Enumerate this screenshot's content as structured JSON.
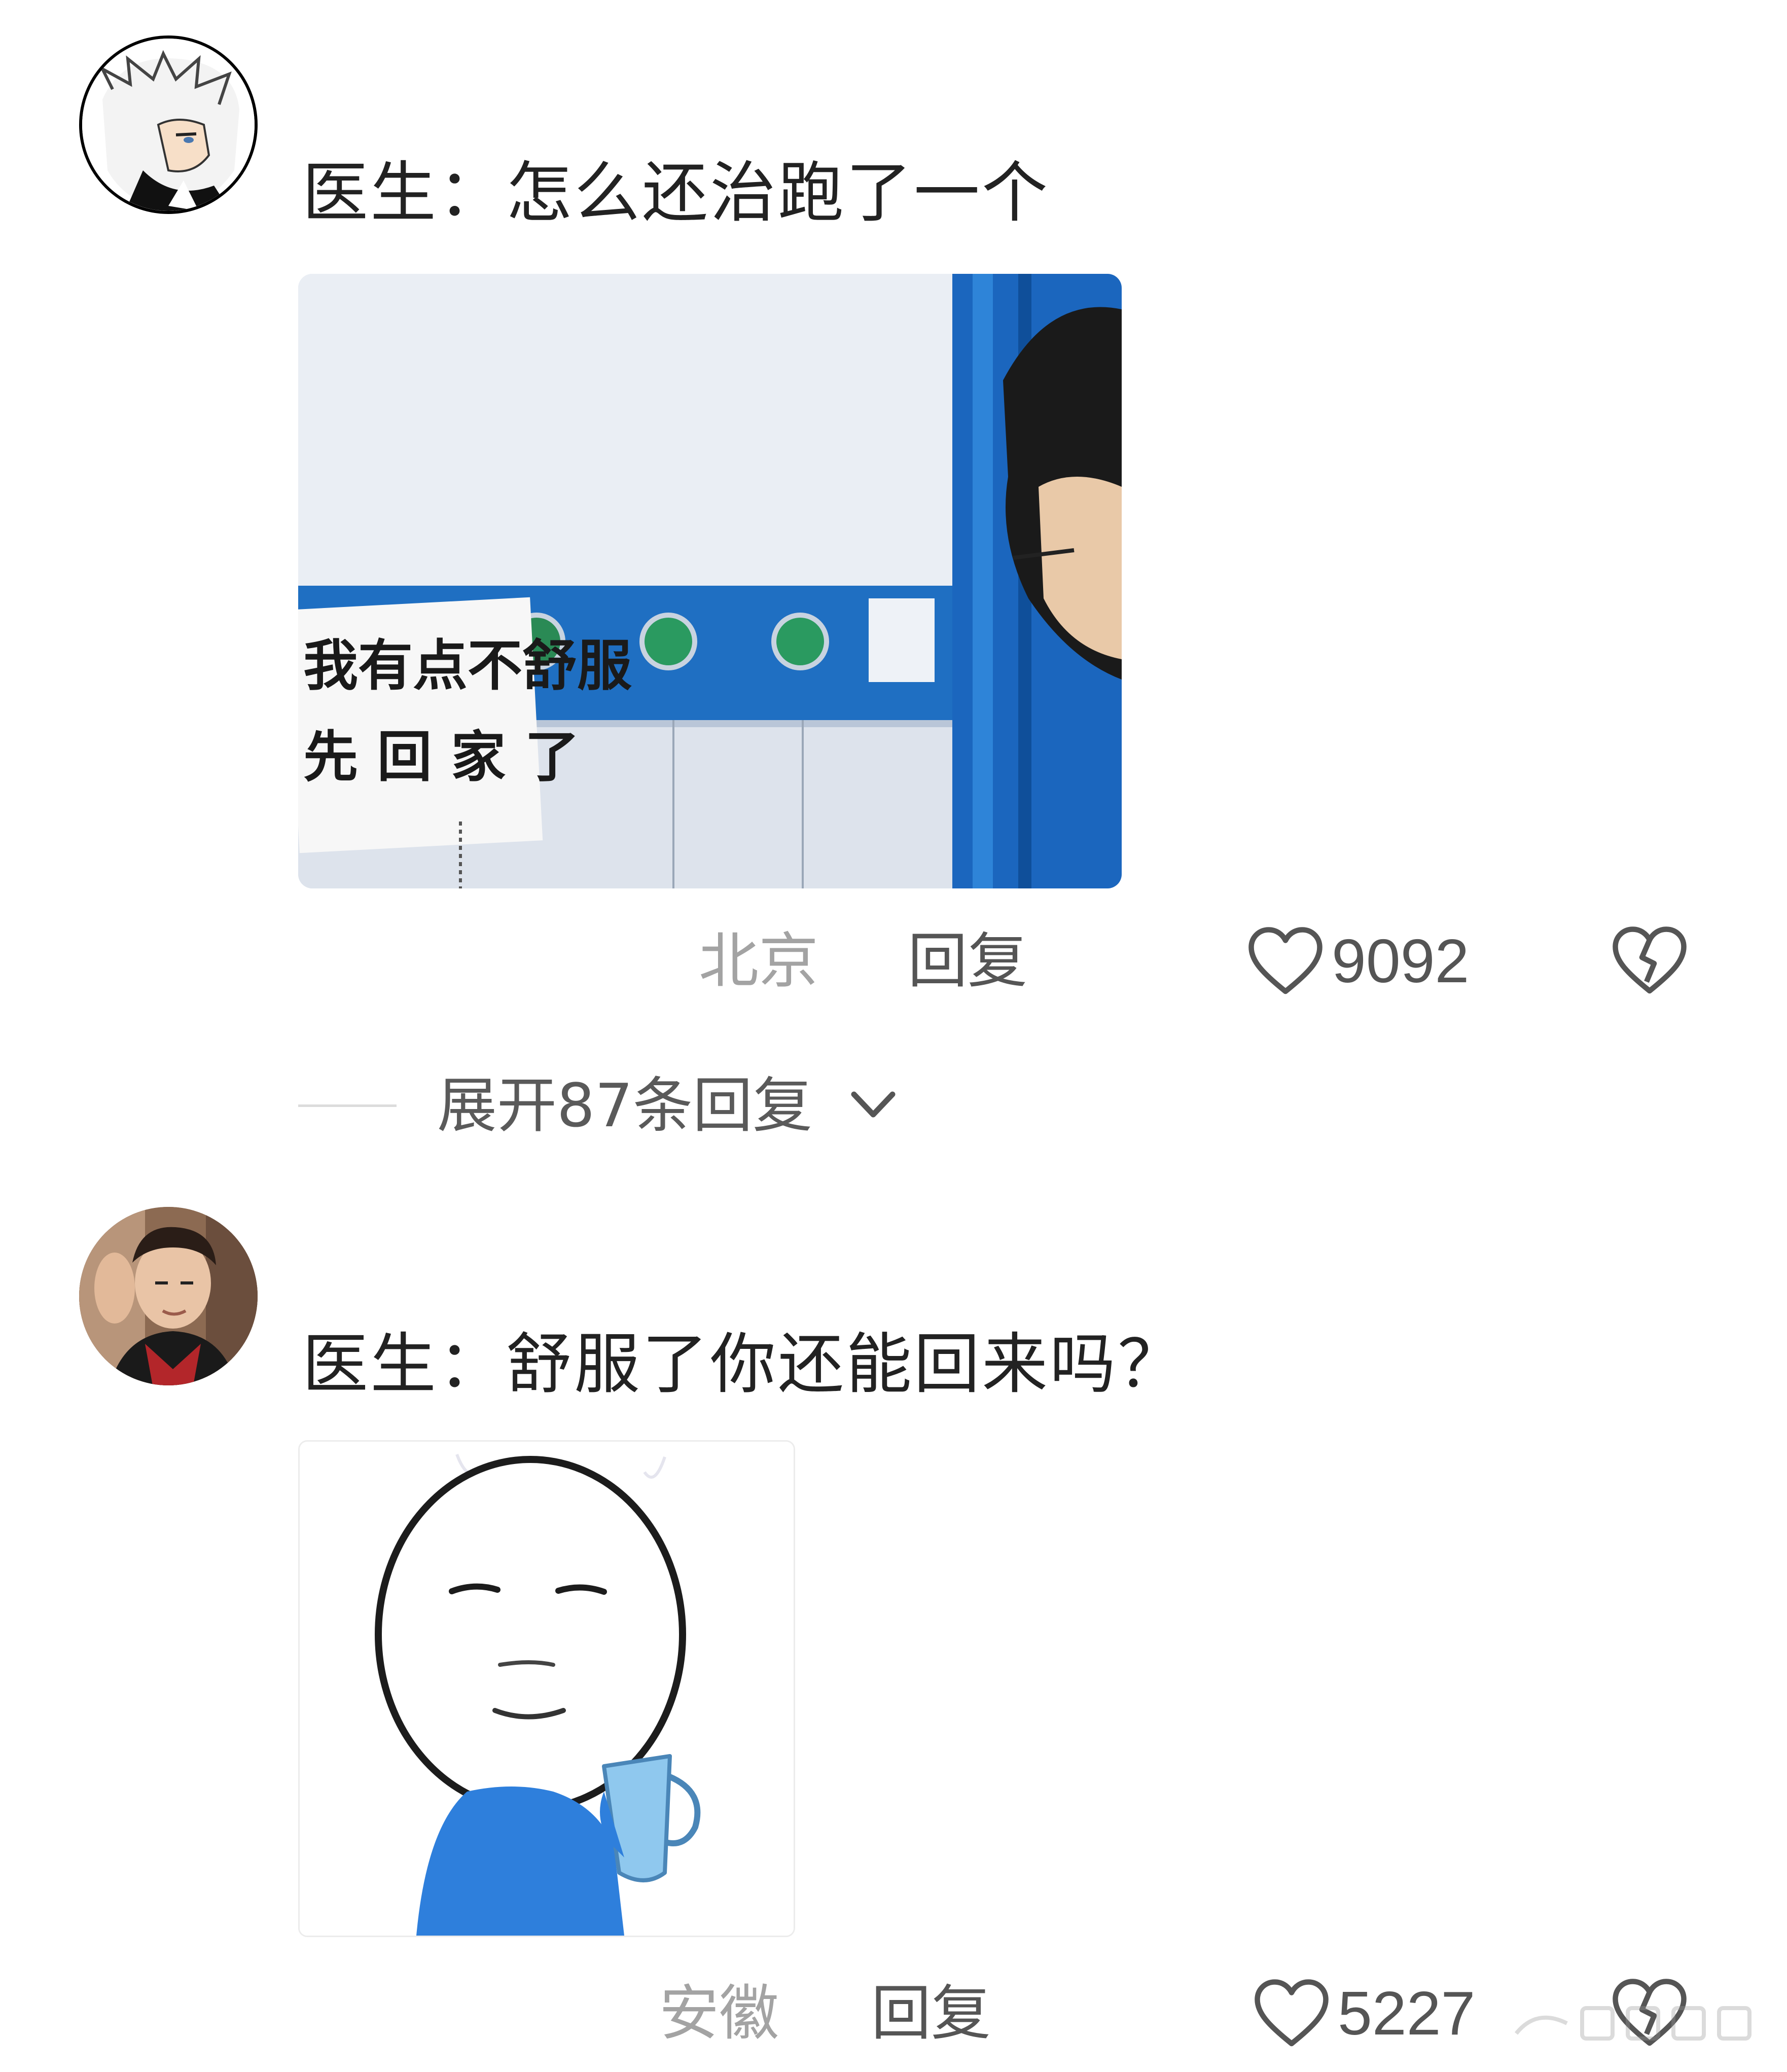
{
  "comments": [
    {
      "text": "医生：怎么还治跑了一个",
      "location": "北京",
      "reply_label": "回复",
      "like_count": "9092",
      "image": {
        "sign_line1": "我有点不舒服",
        "sign_line2": "先 回 家 了"
      }
    },
    {
      "text": "医生：舒服了你还能回来吗？",
      "location": "安徽",
      "reply_label": "回复",
      "like_count": "5227"
    }
  ],
  "expand_replies_label": "展开87条回复",
  "icons": {
    "like": "heart-outline-icon",
    "dislike": "broken-heart-icon",
    "expand": "chevron-down-icon"
  },
  "colors": {
    "text": "#222222",
    "muted": "#a3a3a3",
    "action": "#555555"
  }
}
